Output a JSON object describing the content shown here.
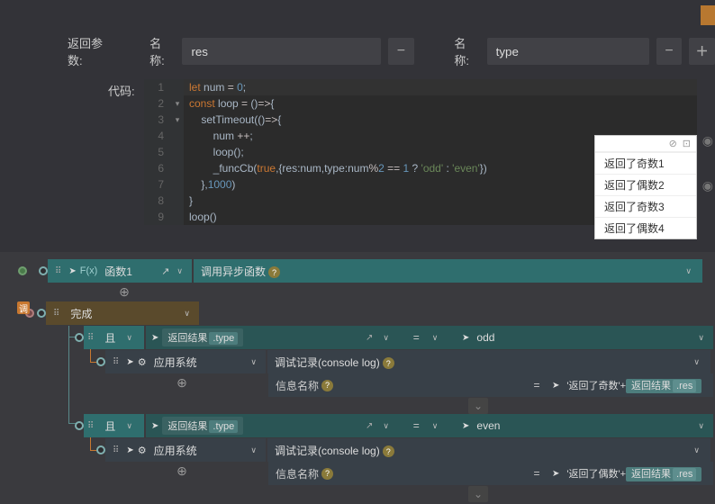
{
  "form": {
    "return_params_label": "返回参数:",
    "name_label": "名称:",
    "param1_value": "res",
    "param2_value": "type"
  },
  "code": {
    "label": "代码:",
    "lines": [
      {
        "n": 1,
        "fold": "",
        "html": "<span class='kw'>let</span> num <span class='op'>=</span> <span class='num'>0</span>;"
      },
      {
        "n": 2,
        "fold": "▾",
        "html": "<span class='kw'>const</span> loop <span class='op'>=</span> ()<span class='op'>=&gt;</span>{"
      },
      {
        "n": 3,
        "fold": "▾",
        "html": "    setTimeout(()<span class='op'>=&gt;</span>{"
      },
      {
        "n": 4,
        "fold": "",
        "html": "        num <span class='op'>++</span>;"
      },
      {
        "n": 5,
        "fold": "",
        "html": "        loop();"
      },
      {
        "n": 6,
        "fold": "",
        "html": "        _funcCb(<span class='bool'>true</span>,{res:num,type:num<span class='op'>%</span><span class='num'>2</span> <span class='op'>==</span> <span class='num'>1</span> ? <span class='str'>'odd'</span> : <span class='str'>'even'</span>})"
      },
      {
        "n": 7,
        "fold": "",
        "html": "    },<span class='num'>1000</span>)"
      },
      {
        "n": 8,
        "fold": "",
        "html": "}"
      },
      {
        "n": 9,
        "fold": "",
        "html": "loop()"
      }
    ]
  },
  "console": {
    "items": [
      "返回了奇数1",
      "返回了偶数2",
      "返回了奇数3",
      "返回了偶数4"
    ]
  },
  "flow": {
    "fn_prefix": "F(x)",
    "fn_label": "函数1",
    "call_async": "调用异步函数",
    "done": "完成",
    "and": "且",
    "return_result": "返回结果",
    "type_suffix": ".type",
    "res_suffix": ".res",
    "eq": "=",
    "odd": "odd",
    "even": "even",
    "app_system": "应用系统",
    "debug_log": "调试记录(console log)",
    "info_name": "信息名称",
    "odd_text": "'返回了奇数'+",
    "even_text": "'返回了偶数'+",
    "tune_tab": "调"
  }
}
